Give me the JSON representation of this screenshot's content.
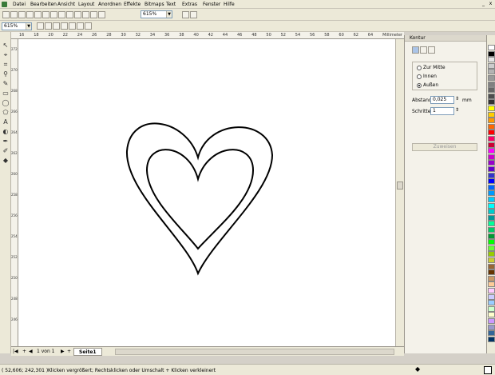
{
  "menu": {
    "items": [
      "Datei",
      "Bearbeiten",
      "Ansicht",
      "Layout",
      "Anordnen",
      "Effekte",
      "Bitmaps",
      "Text",
      "Extras",
      "Fenster",
      "Hilfe"
    ],
    "window_buttons": [
      "_",
      "x"
    ]
  },
  "toolbar": {
    "zoom_value": "615%",
    "zoom_value_2": "615%",
    "unit": "%"
  },
  "ruler": {
    "unit_label": "Millimeter",
    "h_ticks": [
      "16",
      "18",
      "20",
      "22",
      "24",
      "26",
      "28",
      "30",
      "32",
      "34",
      "36",
      "38",
      "40",
      "42",
      "44",
      "46",
      "48",
      "50",
      "52",
      "54",
      "56",
      "58",
      "60",
      "62",
      "64"
    ],
    "v_ticks": [
      "272",
      "270",
      "268",
      "266",
      "264",
      "262",
      "260",
      "258",
      "256",
      "254",
      "252",
      "250",
      "248",
      "246"
    ]
  },
  "docker": {
    "title": "Kontur",
    "options": [
      {
        "label": "Zur Mitte",
        "selected": false
      },
      {
        "label": "Innen",
        "selected": false
      },
      {
        "label": "Außen",
        "selected": true
      }
    ],
    "abstand_label": "Abstand:",
    "abstand_value": "0,025",
    "abstand_unit": "mm",
    "schritte_label": "Schritte:",
    "schritte_value": "1",
    "apply_label": "Zuweisen"
  },
  "pages": {
    "counter": "1 von 1",
    "tab": "Seite1"
  },
  "status": {
    "coords": "( 52,606; 242,301 )",
    "hint": "Klicken vergrößert; Rechtsklicken oder Umschalt + Klicken verkleinert"
  },
  "palette": {
    "colors": [
      "#ffffff",
      "#000000",
      "#e6e6e6",
      "#cccccc",
      "#b3b3b3",
      "#999999",
      "#808080",
      "#666666",
      "#4d4d4d",
      "#333333",
      "#ffff00",
      "#ffcc00",
      "#ff9900",
      "#ff6600",
      "#ff0000",
      "#ff0066",
      "#cc0033",
      "#ff00ff",
      "#cc00cc",
      "#9900cc",
      "#6600cc",
      "#3333cc",
      "#0000ff",
      "#0066ff",
      "#0099ff",
      "#00ccff",
      "#00ffff",
      "#00cccc",
      "#009999",
      "#00ff99",
      "#00cc66",
      "#009933",
      "#00ff00",
      "#66ff33",
      "#99cc00",
      "#cccc33",
      "#996633",
      "#663300",
      "#cc9966",
      "#ffcc99",
      "#ffccff",
      "#ccccff",
      "#99ccff",
      "#ccffcc",
      "#ffffcc",
      "#cc99ff",
      "#9999cc",
      "#336699",
      "#003366"
    ]
  }
}
